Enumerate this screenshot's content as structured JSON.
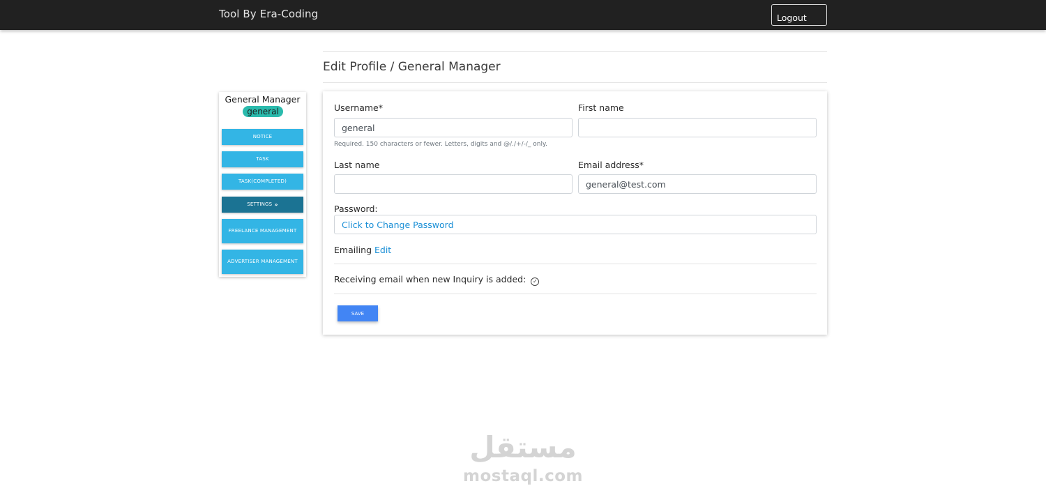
{
  "navbar": {
    "brand": "Tool By Era-Coding",
    "logout_label": "Logout"
  },
  "page": {
    "title": "Edit Profile / General Manager"
  },
  "sidebar": {
    "user_role": "General Manager",
    "username_badge": "general",
    "items": [
      {
        "label": "NOTICE"
      },
      {
        "label": "TASK"
      },
      {
        "label": "TASK(COMPLETED)"
      },
      {
        "label": "SETTINGS",
        "active": true
      },
      {
        "label": "FREELANCE MANAGEMENT"
      },
      {
        "label": "ADVERTISER MANAGEMENT"
      }
    ]
  },
  "form": {
    "username_label": "Username*",
    "username_value": "general",
    "username_hint": "Required. 150 characters or fewer. Letters, digits and @/./+/-/_ only.",
    "first_name_label": "First name",
    "first_name_value": "",
    "last_name_label": "Last name",
    "last_name_value": "",
    "email_label": "Email address*",
    "email_value": "general@test.com",
    "password_label": "Password:",
    "password_link": "Click to Change Password",
    "emailing_label": "Emailing",
    "emailing_edit_link": "Edit",
    "receiving_email_text": "Receiving email when new Inquiry is added:",
    "save_label": "SAVE"
  },
  "watermark": {
    "arabic": "مستقل",
    "latin": "mostaql.com"
  },
  "colors": {
    "navbar_bg": "#212121",
    "sidebar_button": "#33b5e5",
    "sidebar_button_active": "#1b7393",
    "badge": "#2bbbad",
    "save_button": "#4285f4",
    "link": "#1a8fd6"
  }
}
